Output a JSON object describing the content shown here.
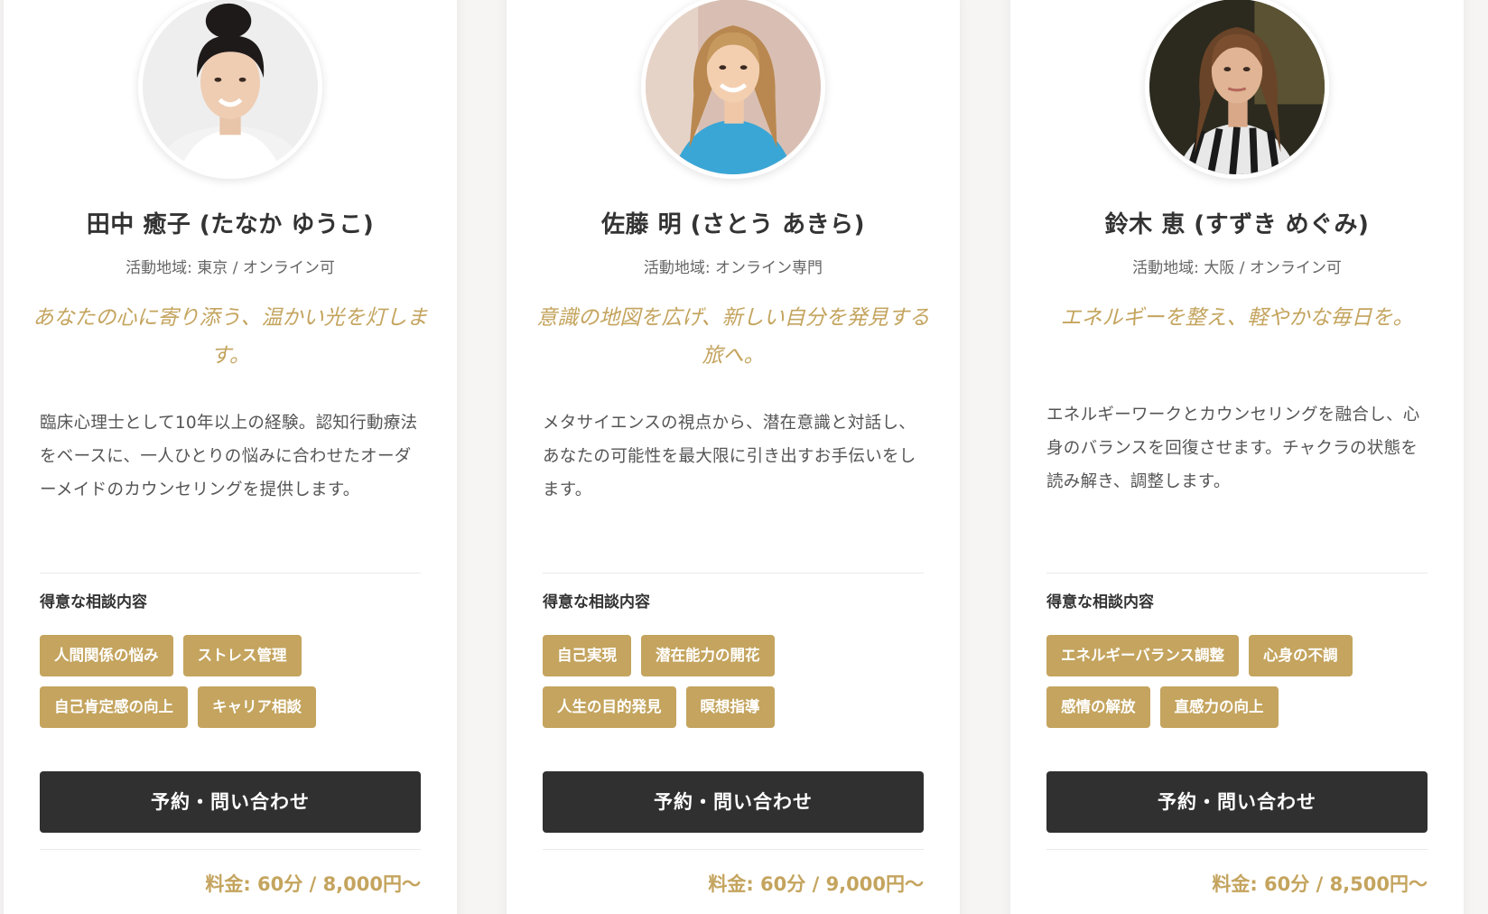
{
  "colors": {
    "accent": "#c4a45e",
    "button": "#303030",
    "text": "#333333",
    "muted": "#666666"
  },
  "common": {
    "specialties_title": "得意な相談内容",
    "cta_label": "予約・問い合わせ"
  },
  "counselors": [
    {
      "name": "田中 癒子 (たなか ゆうこ)",
      "area": "活動地域: 東京 / オンライン可",
      "tagline": "あなたの心に寄り添う、温かい光を灯します。",
      "bio": "臨床心理士として10年以上の経験。認知行動療法をベースに、一人ひとりの悩みに合わせたオーダーメイドのカウンセリングを提供します。",
      "tags_row1": [
        "人間関係の悩み",
        "ストレス管理"
      ],
      "tags_row2": [
        "自己肯定感の向上",
        "キャリア相談"
      ],
      "price": "料金: 60分 / 8,000円〜"
    },
    {
      "name": "佐藤 明 (さとう あきら)",
      "area": "活動地域: オンライン専門",
      "tagline": "意識の地図を広げ、新しい自分を発見する旅へ。",
      "bio": "メタサイエンスの視点から、潜在意識と対話し、あなたの可能性を最大限に引き出すお手伝いをします。",
      "tags_row1": [
        "自己実現",
        "潜在能力の開花"
      ],
      "tags_row2": [
        "人生の目的発見",
        "瞑想指導"
      ],
      "price": "料金: 60分 / 9,000円〜"
    },
    {
      "name": "鈴木 恵 (すずき めぐみ)",
      "area": "活動地域: 大阪 / オンライン可",
      "tagline": "エネルギーを整え、軽やかな毎日を。",
      "bio": "エネルギーワークとカウンセリングを融合し、心身のバランスを回復させます。チャクラの状態を読み解き、調整します。",
      "tags_row1": [
        "エネルギーバランス調整",
        "心身の不調"
      ],
      "tags_row2": [
        "感情の解放",
        "直感力の向上"
      ],
      "price": "料金: 60分 / 8,500円〜"
    }
  ]
}
